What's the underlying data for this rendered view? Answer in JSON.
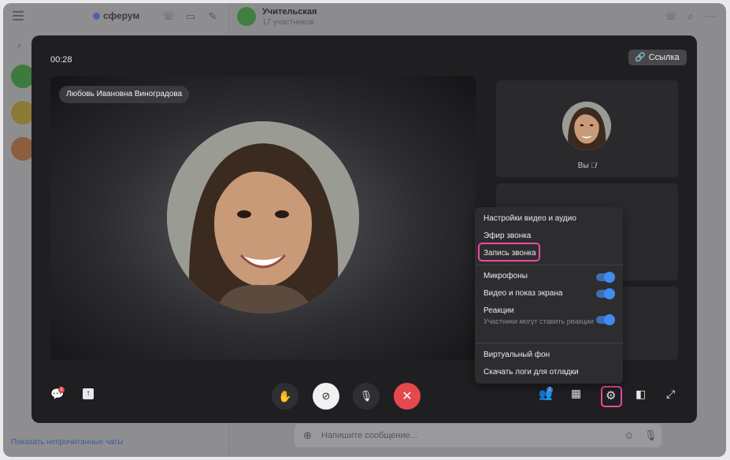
{
  "app": {
    "logo_text": "сферум",
    "chat_title": "Учительская",
    "chat_subtitle": "17 участников",
    "show_unread_link": "Показать непрочитанные чаты",
    "message_placeholder": "Напишите сообщение..."
  },
  "call": {
    "timer": "00:28",
    "link_label": "Ссылка",
    "speaker_name": "Любовь Ивановна Виноградова",
    "self_label": "Вы",
    "chat_badge": "1",
    "participants_badge": "2"
  },
  "settings_menu": {
    "items": [
      "Настройки видео и аудио",
      "Эфир звонка",
      "Запись звонка",
      "Микрофоны",
      "Видео и показ экрана",
      "Реакции",
      "Участники могут ставить реакции",
      "Виртуальный фон",
      "Скачать логи для отладки"
    ],
    "toggles": {
      "microphones": true,
      "video_screen": true,
      "reactions": true
    }
  },
  "colors": {
    "highlight": "#ea4aa0",
    "end_call": "#e5484d",
    "toggle": "#3f8cf2"
  }
}
